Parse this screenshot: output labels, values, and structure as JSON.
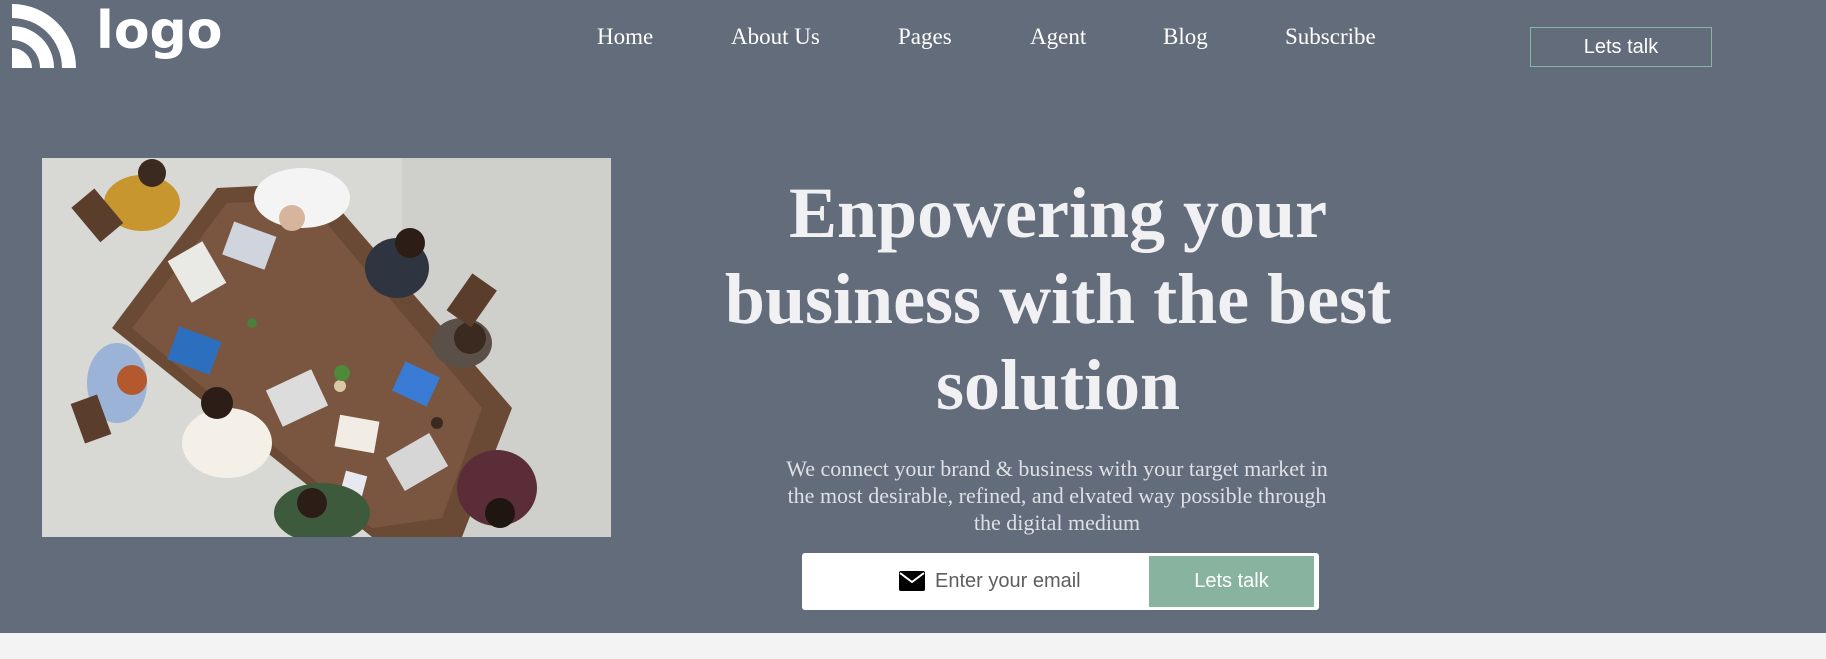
{
  "header": {
    "logo_text": "logo",
    "nav": [
      {
        "label": "Home"
      },
      {
        "label": "About Us"
      },
      {
        "label": "Pages"
      },
      {
        "label": "Agent"
      },
      {
        "label": "Blog"
      },
      {
        "label": "Subscribe"
      }
    ],
    "cta_label": "Lets talk"
  },
  "hero": {
    "headline": "Enpowering your business with the best solution",
    "subtext": "We connect your brand & business with your target market in the most desirable, refined, and elvated way possible through the digital medium",
    "image_icon": "team-meeting-photo",
    "signup": {
      "icon": "envelope-icon",
      "placeholder": "Enter your email",
      "button_label": "Lets talk"
    }
  },
  "colors": {
    "hero_bg": "#636c7a",
    "accent": "#88b39e",
    "page_bg": "#f3f3f3"
  }
}
